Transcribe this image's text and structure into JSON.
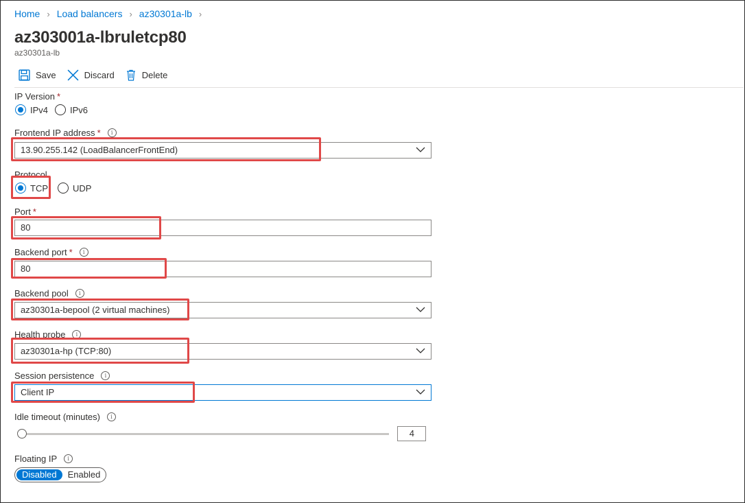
{
  "breadcrumb": [
    "Home",
    "Load balancers",
    "az30301a-lb"
  ],
  "page": {
    "title": "az303001a-lbruletcp80",
    "subtitle": "az30301a-lb"
  },
  "toolbar": {
    "save": "Save",
    "discard": "Discard",
    "delete": "Delete"
  },
  "ip_version": {
    "label": "IP Version",
    "options": [
      "IPv4",
      "IPv6"
    ],
    "selected": "IPv4"
  },
  "frontend_ip": {
    "label": "Frontend IP address",
    "value": "13.90.255.142 (LoadBalancerFrontEnd)"
  },
  "protocol": {
    "label": "Protocol",
    "options": [
      "TCP",
      "UDP"
    ],
    "selected": "TCP"
  },
  "port": {
    "label": "Port",
    "value": "80"
  },
  "backend_port": {
    "label": "Backend port",
    "value": "80"
  },
  "backend_pool": {
    "label": "Backend pool",
    "value": "az30301a-bepool (2 virtual machines)"
  },
  "health_probe": {
    "label": "Health probe",
    "value": "az30301a-hp (TCP:80)"
  },
  "session_persistence": {
    "label": "Session persistence",
    "value": "Client IP"
  },
  "idle_timeout": {
    "label": "Idle timeout (minutes)",
    "value": "4"
  },
  "floating_ip": {
    "label": "Floating IP",
    "options": [
      "Disabled",
      "Enabled"
    ],
    "selected": "Disabled"
  },
  "colors": {
    "accent": "#0078d4",
    "highlight": "#e04848",
    "required": "#a4262c"
  }
}
